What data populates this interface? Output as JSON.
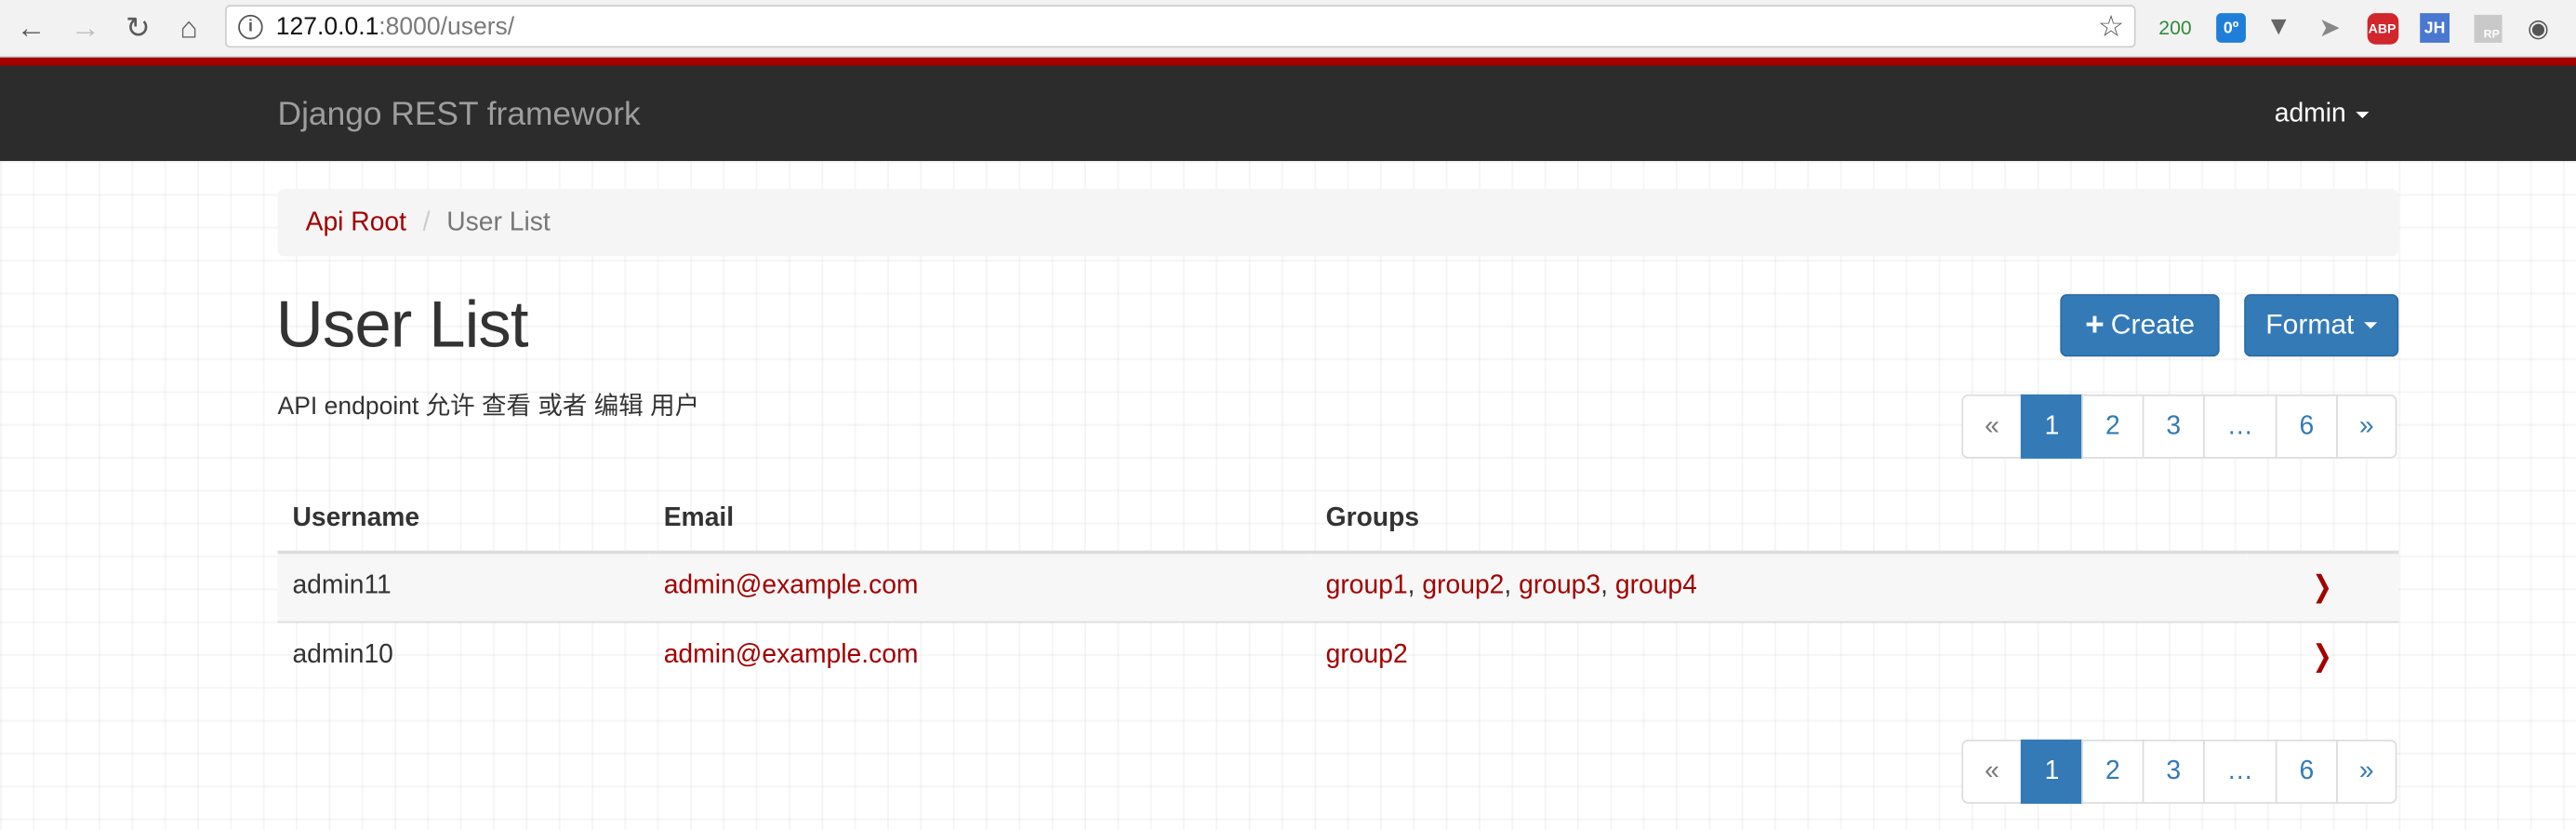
{
  "browser": {
    "url_host": "127.0.0.1",
    "url_rest": ":8000/users/",
    "ext_status_code": "200",
    "ext_cloud_badge": "0º",
    "ext_abp": "ABP",
    "ext_jh": "JH",
    "ext_rp": "RP"
  },
  "navbar": {
    "brand": "Django REST framework",
    "user": "admin"
  },
  "breadcrumb": {
    "root": "Api Root",
    "separator": "/",
    "current": "User List"
  },
  "page": {
    "title": "User List",
    "description": "API endpoint 允许 查看 或者 编辑 用户"
  },
  "buttons": {
    "create": "Create",
    "format": "Format"
  },
  "pagination": {
    "prev": "«",
    "pages": [
      "1",
      "2",
      "3",
      "…",
      "6"
    ],
    "next": "»",
    "active": "1"
  },
  "table": {
    "headers": [
      "Username",
      "Email",
      "Groups"
    ],
    "rows": [
      {
        "username": "admin11",
        "email": "admin@example.com",
        "groups": [
          "group1",
          "group2",
          "group3",
          "group4"
        ]
      },
      {
        "username": "admin10",
        "email": "admin@example.com",
        "groups": [
          "group2"
        ]
      }
    ]
  },
  "colors": {
    "accent": "#a30000",
    "primary": "#337ab7",
    "navbar_bg": "#2c2c2c"
  }
}
